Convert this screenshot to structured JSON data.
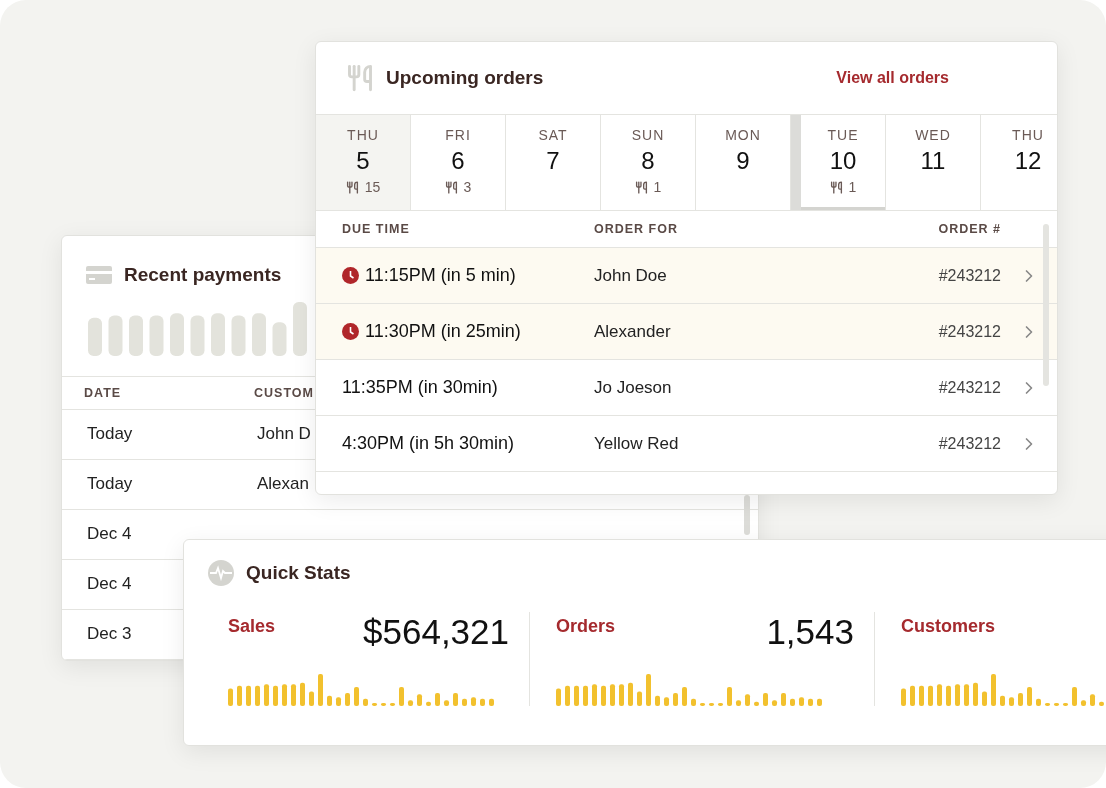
{
  "recent_payments": {
    "title": "Recent payments",
    "columns": [
      "DATE",
      "CUSTOM"
    ],
    "rows": [
      {
        "date": "Today",
        "customer": "John D"
      },
      {
        "date": "Today",
        "customer": "Alexan"
      },
      {
        "date": "Dec 4"
      },
      {
        "date": "Dec 4"
      },
      {
        "date": "Dec 3"
      }
    ]
  },
  "upcoming_orders": {
    "title": "Upcoming orders",
    "link": "View all orders",
    "days": [
      {
        "weekday": "THU",
        "day": "5",
        "count": "15",
        "selected": true,
        "today": false,
        "week_break": false
      },
      {
        "weekday": "FRI",
        "day": "6",
        "count": "3",
        "selected": false,
        "today": false,
        "week_break": false
      },
      {
        "weekday": "SAT",
        "day": "7",
        "selected": false,
        "today": false,
        "week_break": false
      },
      {
        "weekday": "SUN",
        "day": "8",
        "count": "1",
        "selected": false,
        "today": false,
        "week_break": false
      },
      {
        "weekday": "MON",
        "day": "9",
        "selected": false,
        "today": false,
        "week_break": false
      },
      {
        "weekday": "TUE",
        "day": "10",
        "count": "1",
        "selected": false,
        "today": true,
        "week_break": true
      },
      {
        "weekday": "WED",
        "day": "11",
        "selected": false,
        "today": false,
        "week_break": false
      },
      {
        "weekday": "THU",
        "day": "12",
        "selected": false,
        "today": false,
        "week_break": false
      }
    ],
    "columns": [
      "DUE TIME",
      "ORDER FOR",
      "ORDER #"
    ],
    "rows": [
      {
        "due": "11:15PM (in 5 min)",
        "name": "John Doe",
        "order": "#243212",
        "urgent": true
      },
      {
        "due": "11:30PM (in 25min)",
        "name": "Alexander",
        "order": "#243212",
        "urgent": true
      },
      {
        "due": "11:35PM (in 30min)",
        "name": "Jo Joeson",
        "order": "#243212",
        "urgent": false
      },
      {
        "due": "4:30PM (in 5h 30min)",
        "name": "Yellow Red",
        "order": "#243212",
        "urgent": false
      }
    ]
  },
  "quick_stats": {
    "title": "Quick Stats",
    "stats": [
      {
        "label": "Sales",
        "value": "$564,321"
      },
      {
        "label": "Orders",
        "value": "1,543"
      },
      {
        "label": "Customers"
      }
    ]
  }
}
